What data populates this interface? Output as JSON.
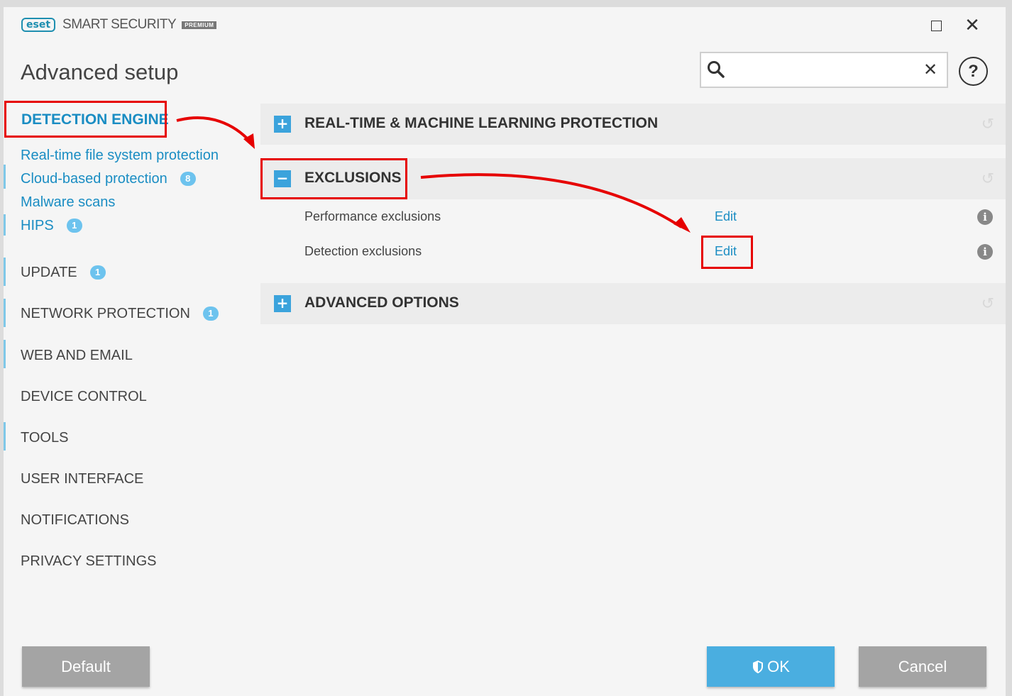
{
  "app": {
    "brand": "eset",
    "product": "SMART SECURITY",
    "edition": "PREMIUM",
    "page_title": "Advanced setup"
  },
  "search": {
    "value": "",
    "placeholder": ""
  },
  "sidebar": {
    "active": "DETECTION ENGINE",
    "sub_items": [
      {
        "label": "Real-time file system protection",
        "badge": ""
      },
      {
        "label": "Cloud-based protection",
        "badge": "8"
      },
      {
        "label": "Malware scans",
        "badge": ""
      },
      {
        "label": "HIPS",
        "badge": "1"
      }
    ],
    "items": [
      {
        "label": "UPDATE",
        "badge": "1"
      },
      {
        "label": "NETWORK PROTECTION",
        "badge": "1"
      },
      {
        "label": "WEB AND EMAIL",
        "badge": ""
      },
      {
        "label": "DEVICE CONTROL",
        "badge": ""
      },
      {
        "label": "TOOLS",
        "badge": ""
      },
      {
        "label": "USER INTERFACE",
        "badge": ""
      },
      {
        "label": "NOTIFICATIONS",
        "badge": ""
      },
      {
        "label": "PRIVACY SETTINGS",
        "badge": ""
      }
    ]
  },
  "main": {
    "sections": [
      {
        "title": "REAL-TIME & MACHINE LEARNING PROTECTION",
        "toggle": "+",
        "expanded": false
      },
      {
        "title": "EXCLUSIONS",
        "toggle": "−",
        "expanded": true
      },
      {
        "title": "ADVANCED OPTIONS",
        "toggle": "+",
        "expanded": false
      }
    ],
    "exclusion_rows": [
      {
        "label": "Performance exclusions",
        "action": "Edit"
      },
      {
        "label": "Detection exclusions",
        "action": "Edit"
      }
    ]
  },
  "footer": {
    "default_label": "Default",
    "ok_label": "OK",
    "cancel_label": "Cancel"
  },
  "colors": {
    "accent": "#1a8dc3",
    "toggle": "#3ba3dc",
    "ok_button": "#4aaee0",
    "neutral_button": "#a4a4a4",
    "highlight": "#e60000"
  }
}
